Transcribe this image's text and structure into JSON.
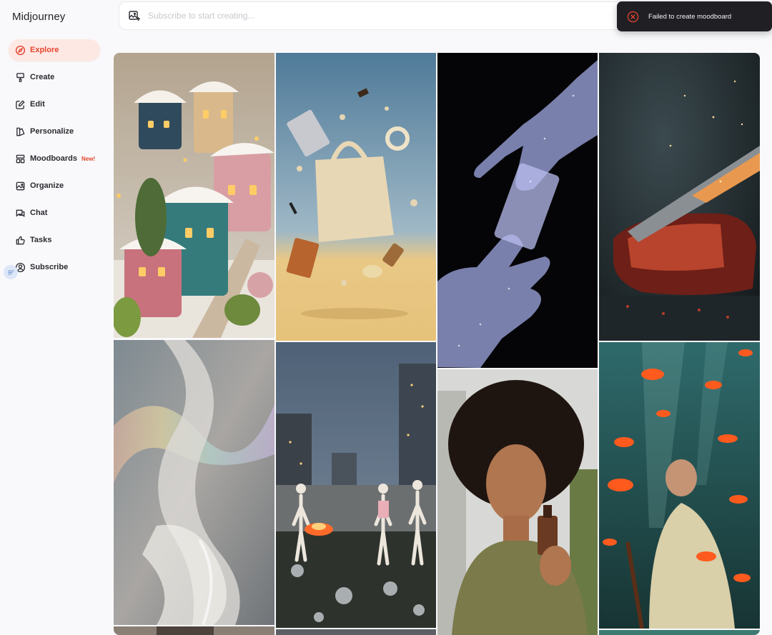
{
  "app": {
    "brand": "Midjourney"
  },
  "sidebar": {
    "items": [
      {
        "label": "Explore",
        "icon": "compass-icon",
        "active": true
      },
      {
        "label": "Create",
        "icon": "paintbrush-icon"
      },
      {
        "label": "Edit",
        "icon": "edit-icon"
      },
      {
        "label": "Personalize",
        "icon": "personalize-icon"
      },
      {
        "label": "Moodboards",
        "icon": "moodboard-icon",
        "badge": "New!"
      },
      {
        "label": "Organize",
        "icon": "image-icon"
      },
      {
        "label": "Chat",
        "icon": "chat-icon"
      },
      {
        "label": "Tasks",
        "icon": "thumbs-up-icon"
      },
      {
        "label": "Subscribe",
        "icon": "user-circle-icon"
      }
    ]
  },
  "search": {
    "placeholder": "Subscribe to start creating...",
    "value": ""
  },
  "toast": {
    "message": "Failed to create moodboard",
    "icon": "error-circle-icon",
    "color": "#e5442e"
  },
  "gallery": {
    "images": [
      {
        "subject": "knitted winter village houses"
      },
      {
        "subject": "floating tote bag with gadgets"
      },
      {
        "subject": "wireframe hands passing a card"
      },
      {
        "subject": "knife slicing steak with sparks"
      },
      {
        "subject": "iridescent abstract cloud wave"
      },
      {
        "subject": "skeletons around a bonfire at dusk"
      },
      {
        "subject": "woman holding a serum bottle"
      },
      {
        "subject": "woman among goldfish underwater"
      }
    ]
  },
  "colors": {
    "accent": "#e5442e",
    "active_bg": "#fde8e4"
  }
}
